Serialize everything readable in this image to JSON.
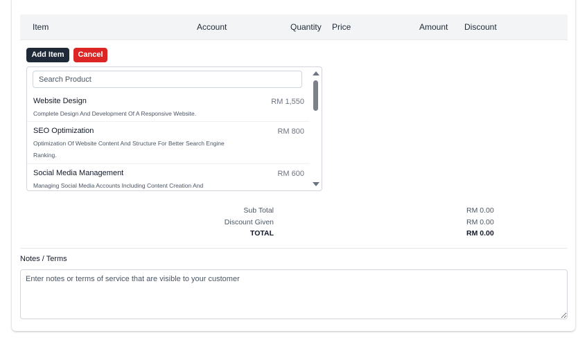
{
  "table": {
    "headers": [
      "Item",
      "Account",
      "Quantity",
      "Price",
      "Amount",
      "Discount"
    ]
  },
  "buttons": {
    "add_item": "Add Item",
    "cancel": "Cancel"
  },
  "product_search": {
    "placeholder": "Search Product",
    "products": [
      {
        "name": "Website Design",
        "price": "RM 1,550",
        "description": "Complete Design And Development Of A Responsive Website."
      },
      {
        "name": "SEO Optimization",
        "price": "RM 800",
        "description": "Optimization Of Website Content And Structure For Better Search Engine Ranking."
      },
      {
        "name": "Social Media Management",
        "price": "RM 600",
        "description": "Managing Social Media Accounts Including Content Creation And"
      }
    ]
  },
  "totals": {
    "sub_total_label": "Sub Total",
    "sub_total_value": "RM 0.00",
    "discount_label": "Discount Given",
    "discount_value": "RM 0.00",
    "total_label": "TOTAL",
    "total_value": "RM 0.00"
  },
  "notes": {
    "label": "Notes / Terms",
    "placeholder": "Enter notes or terms of service that are visible to your customer"
  }
}
